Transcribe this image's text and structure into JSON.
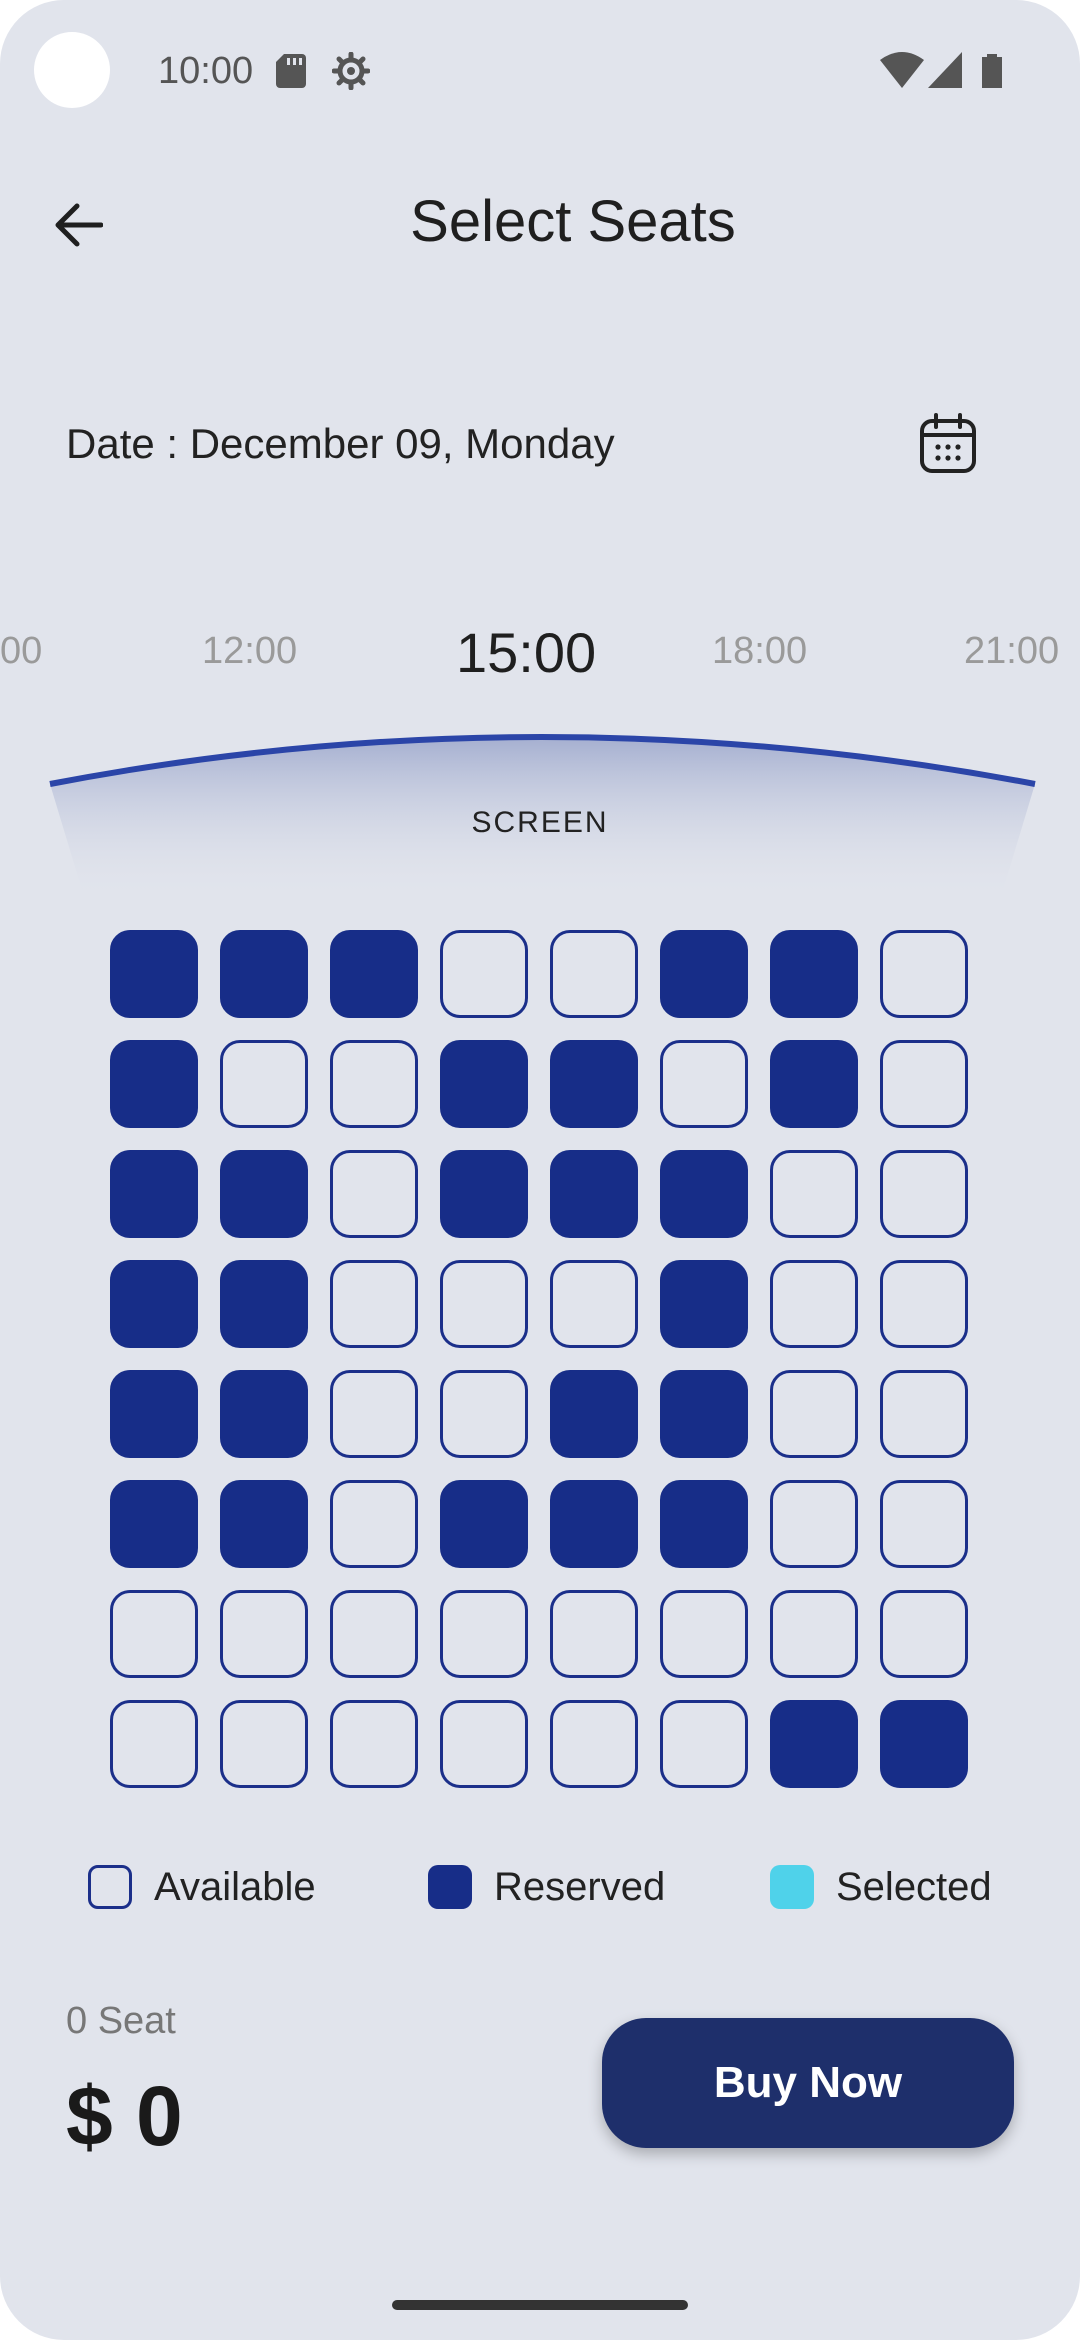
{
  "status_bar": {
    "time": "10:00"
  },
  "header": {
    "title": "Select Seats"
  },
  "date": {
    "label": "Date : December 09, Monday"
  },
  "showtimes": [
    {
      "label": "00",
      "active": false
    },
    {
      "label": "12:00",
      "active": false
    },
    {
      "label": "15:00",
      "active": true
    },
    {
      "label": "18:00",
      "active": false
    },
    {
      "label": "21:00",
      "active": false
    }
  ],
  "screen": {
    "label": "SCREEN"
  },
  "seat_map": [
    [
      "reserved",
      "reserved",
      "reserved",
      "available",
      "available",
      "reserved",
      "reserved",
      "available"
    ],
    [
      "reserved",
      "available",
      "available",
      "reserved",
      "reserved",
      "available",
      "reserved",
      "available"
    ],
    [
      "reserved",
      "reserved",
      "available",
      "reserved",
      "reserved",
      "reserved",
      "available",
      "available"
    ],
    [
      "reserved",
      "reserved",
      "available",
      "available",
      "available",
      "reserved",
      "available",
      "available"
    ],
    [
      "reserved",
      "reserved",
      "available",
      "available",
      "reserved",
      "reserved",
      "available",
      "available"
    ],
    [
      "reserved",
      "reserved",
      "available",
      "reserved",
      "reserved",
      "reserved",
      "available",
      "available"
    ],
    [
      "available",
      "available",
      "available",
      "available",
      "available",
      "available",
      "available",
      "available"
    ],
    [
      "available",
      "available",
      "available",
      "available",
      "available",
      "available",
      "reserved",
      "reserved"
    ]
  ],
  "legend": {
    "available": "Available",
    "reserved": "Reserved",
    "selected": "Selected"
  },
  "summary": {
    "seat_count": "0 Seat",
    "total_price": "$ 0",
    "buy_label": "Buy Now"
  },
  "colors": {
    "background": "#e1e4ec",
    "reserved": "#172d88",
    "selected": "#4fd2ea",
    "button": "#1e2f6b"
  }
}
